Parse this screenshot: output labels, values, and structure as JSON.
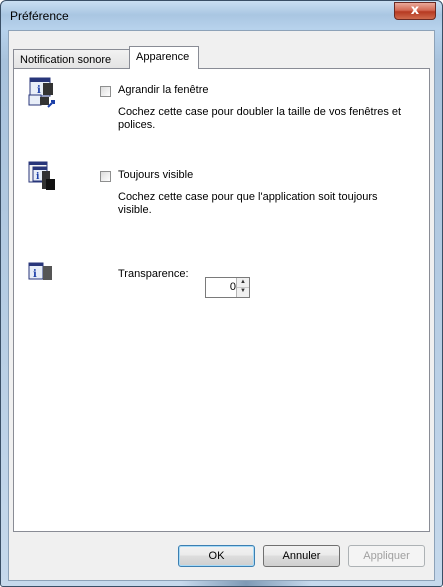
{
  "window": {
    "title": "Préférence",
    "close_glyph": "x"
  },
  "tabs": [
    {
      "label": "Notification sonore",
      "active": false
    },
    {
      "label": "Apparence",
      "active": true
    }
  ],
  "options": {
    "enlarge": {
      "label": "Agrandir la fenêtre",
      "checked": false,
      "desc_line1": "Cochez cette case pour doubler la taille de vos fenêtres et",
      "desc_line2": "polices.",
      "icon": "window-resize-icon"
    },
    "always_visible": {
      "label": "Toujours visible",
      "checked": false,
      "desc_line1": "Cochez cette case pour que l'application soit toujours",
      "desc_line2": "visible.",
      "icon": "window-stack-icon"
    },
    "transparency": {
      "label": "Transparence:",
      "value": "0",
      "icon": "transparency-icon"
    }
  },
  "buttons": {
    "ok": "OK",
    "cancel": "Annuler",
    "apply": "Appliquer"
  },
  "colors": {
    "accent": "#1c3fa8",
    "title_bg": "#b7d2ec",
    "close": "#c9462c"
  }
}
